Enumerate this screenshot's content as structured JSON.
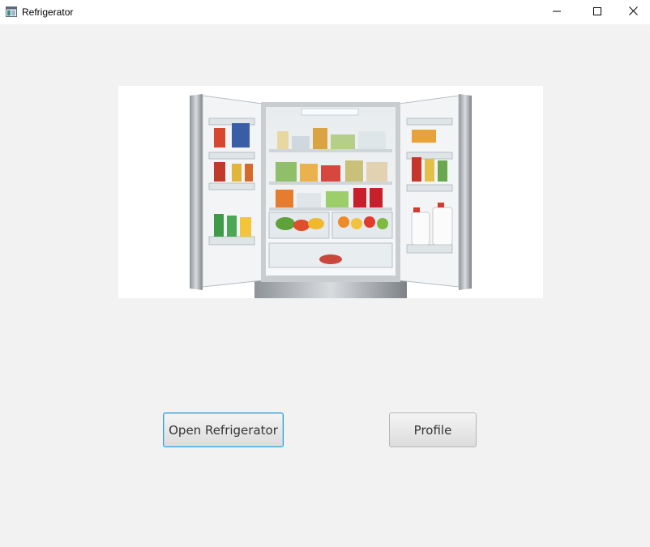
{
  "window": {
    "title": "Refrigerator",
    "app_icon": "app-window-icon",
    "controls": {
      "minimize_icon": "minimize-icon",
      "maximize_icon": "maximize-icon",
      "close_icon": "close-icon"
    }
  },
  "main": {
    "image": {
      "subject": "open-refrigerator-photo"
    },
    "buttons": {
      "open_label": "Open Refrigerator",
      "profile_label": "Profile"
    }
  },
  "colors": {
    "background": "#f2f2f2",
    "focus_border": "#2d9ad7",
    "button_text": "#333333"
  }
}
